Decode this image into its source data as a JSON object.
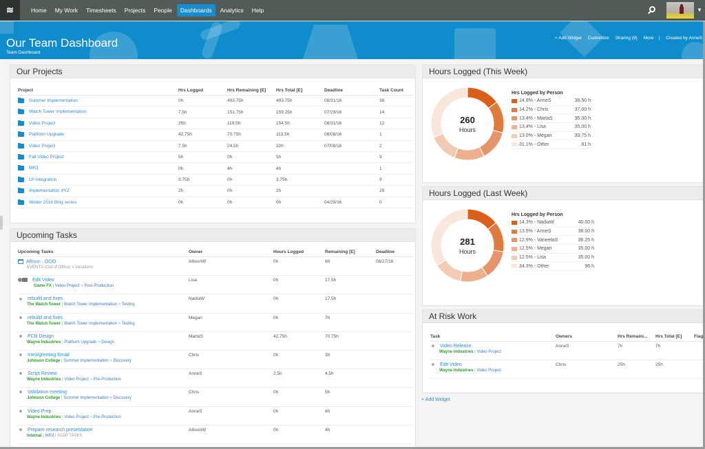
{
  "nav": {
    "logo_icon": "wrike-logo-icon",
    "items": [
      {
        "label": "Home",
        "active": false
      },
      {
        "label": "My Work",
        "active": false
      },
      {
        "label": "Timesheets",
        "active": false
      },
      {
        "label": "Projects",
        "active": false
      },
      {
        "label": "People",
        "active": false
      },
      {
        "label": "Dashboards",
        "active": true
      },
      {
        "label": "Analytics",
        "active": false
      },
      {
        "label": "Help",
        "active": false
      }
    ],
    "caret": "▼"
  },
  "banner": {
    "title": "Our Team Dashboard",
    "subtitle": "Team Dashboard",
    "actions": {
      "add_widget": "+ Add Widget",
      "customize": "Customize",
      "sharing": "Sharing (9)",
      "more": "More",
      "separator": "|",
      "created_by": "Created by AnneS"
    }
  },
  "projects": {
    "title": "Our Projects",
    "columns": [
      "Project",
      "Hrs Logged",
      "Hrs Remaining [E]",
      "Hrs Total [E]",
      "Deadline",
      "Task Count"
    ],
    "rows": [
      [
        "Summer Implementation",
        "0h",
        "493.75h",
        "493.75h",
        "08/31/16",
        "38"
      ],
      [
        "Watch Tower Implementation",
        "7.5h",
        "151.75h",
        "159.25h",
        "07/29/16",
        "14"
      ],
      [
        "Video Project",
        "35h",
        "119.5h",
        "154.5h",
        "08/31/16",
        "12"
      ],
      [
        "Platform Upgrade",
        "42.75h",
        "70.75h",
        "113.5h",
        "08/08/16",
        "1"
      ],
      [
        "Video Project",
        "7.5h",
        "24.5h",
        "32h",
        "07/08/16",
        "2"
      ],
      [
        "Fall Video Project",
        "5h",
        "0h",
        "5h",
        "",
        "9"
      ],
      [
        "MR3",
        "0h",
        "4h",
        "4h",
        "",
        "1"
      ],
      [
        "LP Integration",
        "3.75h",
        "0h",
        "3.75h",
        "",
        "9"
      ],
      [
        "Implementation XYZ",
        "2h",
        "0h",
        "2h",
        "",
        "29"
      ],
      [
        "Winter 2016 Blog series",
        "0h",
        "0h",
        "0h",
        "04/29/16",
        "0"
      ]
    ]
  },
  "tasks": {
    "title": "Upcoming Tasks",
    "columns": [
      "Upcoming Tasks",
      "Owner",
      "Hours Logged",
      "Remaining [E]",
      "Deadline"
    ],
    "rows": [
      {
        "icon": "calendar-icon",
        "name": "Allison - OOO",
        "client": "",
        "path": [
          "EVENTS (Out of Office)",
          "Vacations"
        ],
        "path_style": "gray",
        "owner": "AllisonW",
        "logged": "0h",
        "remaining": "6h",
        "deadline": "06/27/16"
      },
      {
        "icon": "toggle-icon",
        "name": "Edit Video",
        "client": "Game FX",
        "path": [
          "Video Project",
          "Post-Production"
        ],
        "path_style": "crumb",
        "owner": "Lisa",
        "logged": "0h",
        "remaining": "17.5h",
        "deadline": ""
      },
      {
        "icon": "bullet-icon",
        "name": "rebuild and fixes",
        "client": "The Watch Tower",
        "path": [
          "Watch Tower Implementation",
          "Testing"
        ],
        "path_style": "crumb",
        "owner": "NadiaW",
        "logged": "0h",
        "remaining": "17.5h",
        "deadline": ""
      },
      {
        "icon": "bullet-icon",
        "name": "rebuild and fixes",
        "client": "The Watch Tower",
        "path": [
          "Watch Tower Implementation",
          "Testing"
        ],
        "path_style": "crumb",
        "owner": "Megan",
        "logged": "0h",
        "remaining": "7h",
        "deadline": ""
      },
      {
        "icon": "bullet-icon",
        "name": "PCB Design",
        "client": "Wayne Industries",
        "path": [
          "Platform Upgrade",
          "Design"
        ],
        "path_style": "crumb",
        "owner": "MartaS",
        "logged": "42.75h",
        "remaining": "70.75h",
        "deadline": ""
      },
      {
        "icon": "bullet-icon",
        "name": "Intro/greeting Email",
        "client": "Johnson College",
        "path": [
          "Summer Implementation",
          "Discovery"
        ],
        "path_style": "crumb",
        "owner": "Chris",
        "logged": "0h",
        "remaining": "3h",
        "deadline": ""
      },
      {
        "icon": "bullet-icon",
        "name": "Script Review",
        "client": "Wayne Industries",
        "path": [
          "Video Project",
          "Pre-Production"
        ],
        "path_style": "crumb",
        "owner": "AnneS",
        "logged": "2.5h",
        "remaining": "4.5h",
        "deadline": ""
      },
      {
        "icon": "bullet-icon",
        "name": "Validation meeting",
        "client": "Johnson College",
        "path": [
          "Summer Implementation",
          "Discovery"
        ],
        "path_style": "crumb",
        "owner": "Chris",
        "logged": "0h",
        "remaining": "5h",
        "deadline": ""
      },
      {
        "icon": "bullet-icon",
        "name": "Video Prep",
        "client": "Wayne Industries",
        "path": [
          "Video Project",
          "Pre-Production"
        ],
        "path_style": "crumb",
        "owner": "AnneS",
        "logged": "0h",
        "remaining": "6h",
        "deadline": ""
      },
      {
        "icon": "bullet-icon",
        "name": "Prepare research presentation",
        "client": "Internal",
        "path": [
          "MR3",
          "ASAP TASKS"
        ],
        "path_style": "pipe",
        "owner": "AllisonW",
        "logged": "0h",
        "remaining": "4h",
        "deadline": ""
      }
    ]
  },
  "chart_data": [
    {
      "type": "pie",
      "title": "Hours Logged (This Week)",
      "center_value": "260",
      "center_label": "Hours",
      "legend_title": "Hrs Logged by Person",
      "legend_placement": "right",
      "slices": [
        {
          "label": "14.8% - AnneS",
          "name": "AnneS",
          "percent": 14.8,
          "value": "38.50 h",
          "color": "#d95f1a"
        },
        {
          "label": "14.2% - Chris",
          "name": "Chris",
          "percent": 14.2,
          "value": "37.00 h",
          "color": "#e07b3e"
        },
        {
          "label": "13.4% - MartaS",
          "name": "MartaS",
          "percent": 13.4,
          "value": "35.00 h",
          "color": "#e6956a"
        },
        {
          "label": "13.4% - Lisa",
          "name": "Lisa",
          "percent": 13.4,
          "value": "35.00 h",
          "color": "#edb08f"
        },
        {
          "label": "13.0% - Megan",
          "name": "Megan",
          "percent": 13.0,
          "value": "33.75 h",
          "color": "#f2cbb4"
        },
        {
          "label": "31.1% - Other",
          "name": "Other",
          "percent": 31.1,
          "value": "81 h",
          "color": "#f9e7dc"
        }
      ]
    },
    {
      "type": "pie",
      "title": "Hours Logged (Last Week)",
      "center_value": "281",
      "center_label": "Hours",
      "legend_title": "Hrs Logged by Person",
      "legend_placement": "right",
      "slices": [
        {
          "label": "14.3% - NadiaW",
          "name": "NadiaW",
          "percent": 14.3,
          "value": "40.00 h",
          "color": "#d95f1a"
        },
        {
          "label": "13.5% - AnneS",
          "name": "AnneS",
          "percent": 13.5,
          "value": "38.00 h",
          "color": "#e07b3e"
        },
        {
          "label": "12.9% - VaneetaS",
          "name": "VaneetaS",
          "percent": 12.9,
          "value": "36.25 h",
          "color": "#e6956a"
        },
        {
          "label": "12.5% - Megan",
          "name": "Megan",
          "percent": 12.5,
          "value": "35.00 h",
          "color": "#edb08f"
        },
        {
          "label": "12.5% - Lisa",
          "name": "Lisa",
          "percent": 12.5,
          "value": "35.00 h",
          "color": "#f2cbb4"
        },
        {
          "label": "34.3% - Other",
          "name": "Other",
          "percent": 34.3,
          "value": "96 h",
          "color": "#f9e7dc"
        }
      ]
    }
  ],
  "risk": {
    "title": "At Risk Work",
    "columns": [
      "Task",
      "Owners",
      "Hrs Remaini...",
      "Hrs Total [E]",
      "Flag"
    ],
    "rows": [
      {
        "name": "Video Release",
        "client": "Wayne Industries",
        "project": "Video Project",
        "owner": "AnneS",
        "remaining": "7h",
        "total": "7h",
        "flag": ""
      },
      {
        "name": "Edit Video",
        "client": "Wayne Industries",
        "project": "Video Project",
        "owner": "Chris",
        "remaining": "25h",
        "total": "25h",
        "flag": ""
      }
    ]
  },
  "footer": {
    "add_widget": "+ Add Widget"
  },
  "colors": {
    "accent": "#1a8ccc",
    "nav_bg": "#535a5a",
    "link": "#2a8fcf",
    "client_green": "#2c9a2c"
  }
}
